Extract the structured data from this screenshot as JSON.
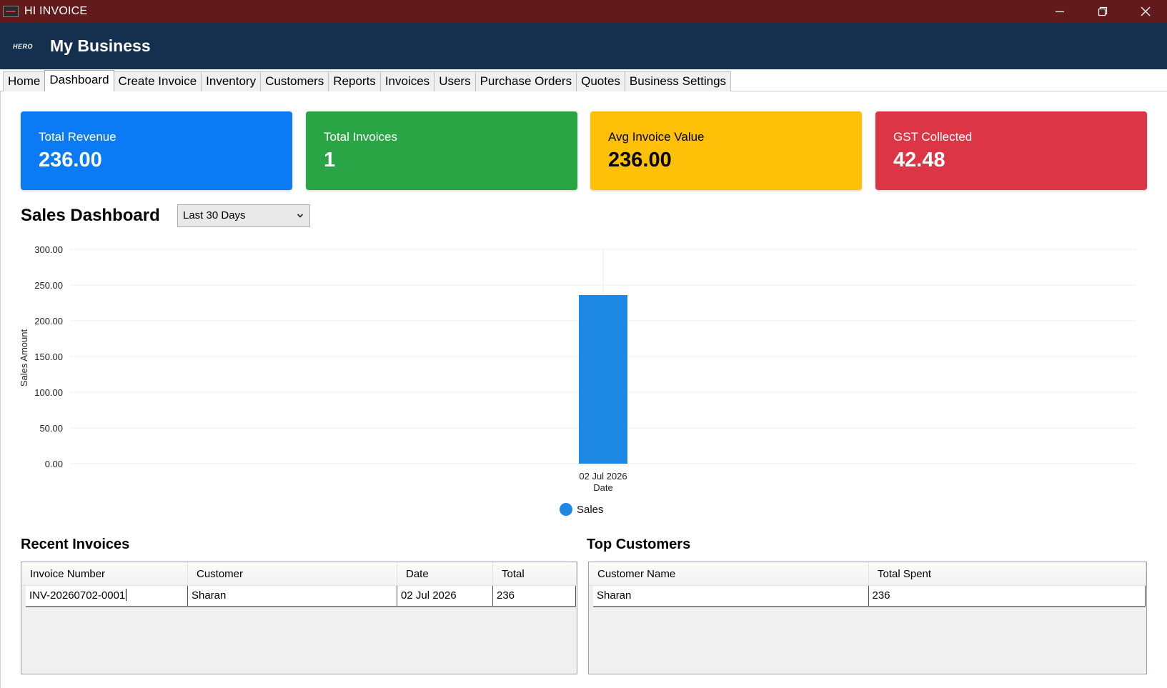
{
  "window": {
    "title": "HI INVOICE",
    "controls": [
      "minimize-icon",
      "restore-icon",
      "close-icon"
    ]
  },
  "header": {
    "logo_text": "HERO",
    "business_name": "My Business"
  },
  "tabs": [
    {
      "label": "Home"
    },
    {
      "label": "Dashboard",
      "active": true
    },
    {
      "label": "Create Invoice"
    },
    {
      "label": "Inventory"
    },
    {
      "label": "Customers"
    },
    {
      "label": "Reports"
    },
    {
      "label": "Invoices"
    },
    {
      "label": "Users"
    },
    {
      "label": "Purchase Orders"
    },
    {
      "label": "Quotes"
    },
    {
      "label": "Business Settings"
    }
  ],
  "cards": {
    "revenue": {
      "label": "Total Revenue",
      "value": "236.00",
      "color": "#0a7bf5"
    },
    "invoices": {
      "label": "Total Invoices",
      "value": "1",
      "color": "#29a545"
    },
    "avg": {
      "label": "Avg Invoice Value",
      "value": "236.00",
      "color": "#ffc107"
    },
    "gst": {
      "label": "GST Collected",
      "value": "42.48",
      "color": "#dc3545"
    }
  },
  "sales_dashboard": {
    "title": "Sales Dashboard",
    "period": {
      "selected": "Last 30 Days"
    }
  },
  "chart_data": {
    "type": "bar",
    "categories": [
      "02 Jul 2026"
    ],
    "series": [
      {
        "name": "Sales",
        "values": [
          236
        ],
        "color": "#1e88e5"
      }
    ],
    "xlabel": "Date",
    "ylabel": "Sales Amount",
    "ylim": [
      0,
      300
    ],
    "yticks": [
      "0.00",
      "50.00",
      "100.00",
      "150.00",
      "200.00",
      "250.00",
      "300.00"
    ],
    "grid": true,
    "legend": "bottom-center"
  },
  "recent_invoices": {
    "title": "Recent Invoices",
    "columns": [
      "Invoice Number",
      "Customer",
      "Date",
      "Total"
    ],
    "rows": [
      [
        "INV-20260702-0001",
        "Sharan",
        "02 Jul 2026",
        "236"
      ]
    ]
  },
  "top_customers": {
    "title": "Top Customers",
    "columns": [
      "Customer Name",
      "Total Spent"
    ],
    "rows": [
      [
        "Sharan",
        "236"
      ]
    ]
  }
}
